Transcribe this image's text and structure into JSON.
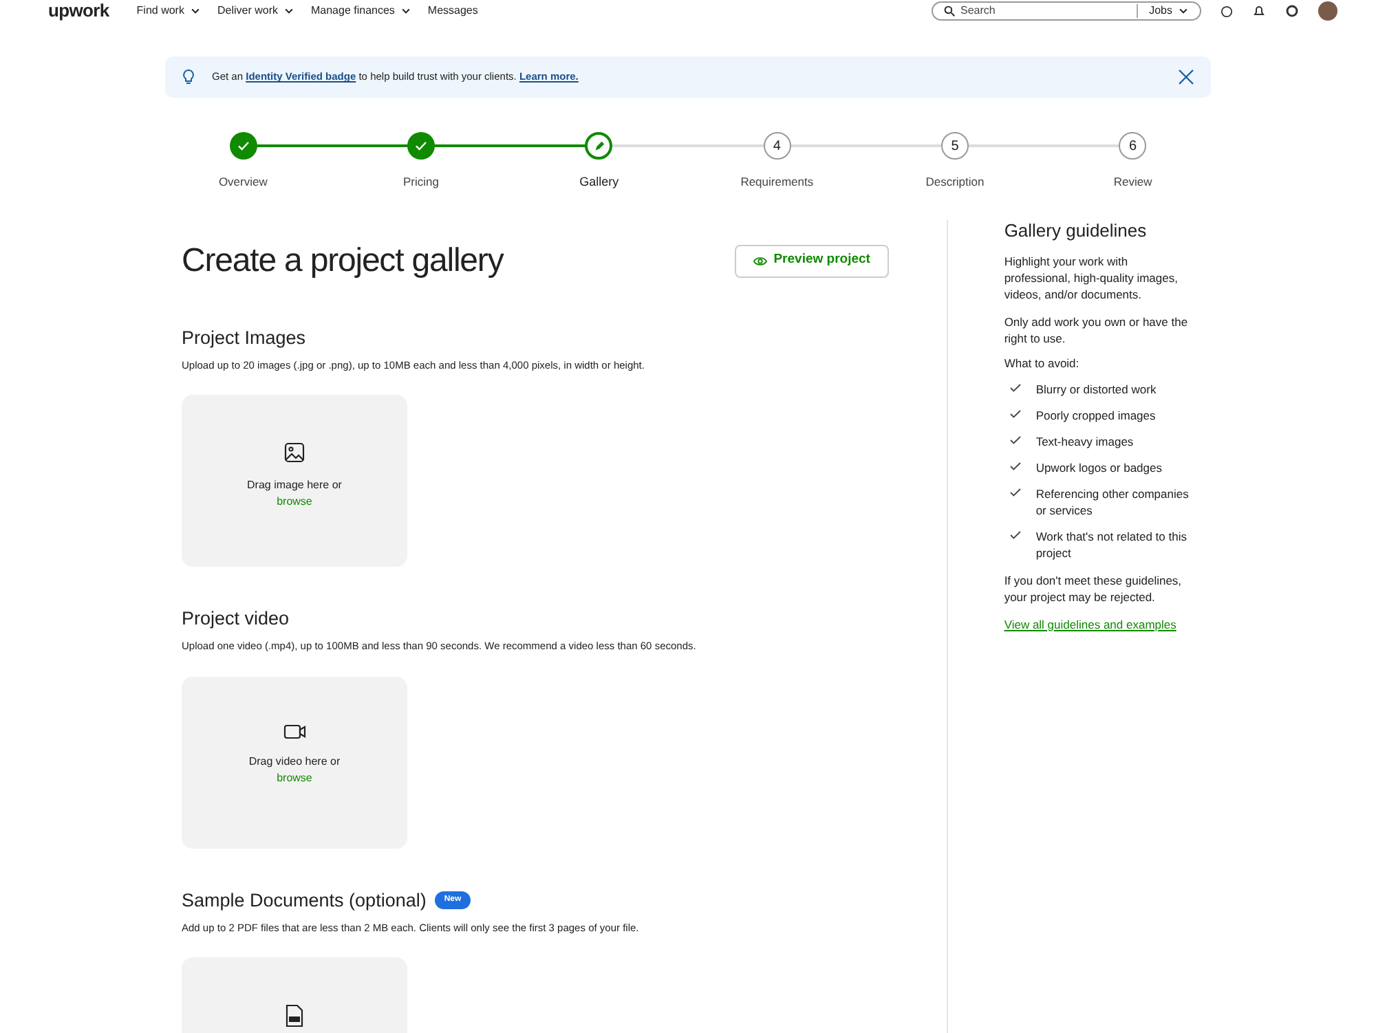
{
  "nav": {
    "logo": "upwork",
    "links": [
      {
        "label": "Find work",
        "dropdown": true
      },
      {
        "label": "Deliver work",
        "dropdown": true
      },
      {
        "label": "Manage finances",
        "dropdown": true
      },
      {
        "label": "Messages",
        "dropdown": false
      }
    ],
    "search": {
      "placeholder": "Search",
      "scope": "Jobs"
    }
  },
  "banner": {
    "before": "Get an ",
    "badge_link": "Identity Verified badge",
    "middle": " to help build trust with your clients. ",
    "learn_link": "Learn more."
  },
  "steps": [
    {
      "label": "Overview",
      "kind": "done"
    },
    {
      "label": "Pricing",
      "kind": "done"
    },
    {
      "label": "Gallery",
      "kind": "current"
    },
    {
      "label": "Requirements",
      "kind": "upcoming",
      "number": "4"
    },
    {
      "label": "Description",
      "kind": "upcoming",
      "number": "5"
    },
    {
      "label": "Review",
      "kind": "upcoming",
      "number": "6"
    }
  ],
  "title": "Create a project gallery",
  "preview_button": "Preview project",
  "sections": [
    {
      "heading": "Project Images",
      "description": "Upload up to 20 images (.jpg or .png), up to 10MB each and less than 4,000 pixels, in width or height.",
      "kind": "image",
      "drop_text": "Drag image here or",
      "browse": "browse"
    },
    {
      "heading": "Project video",
      "description": "Upload one video (.mp4), up to 100MB and less than 90 seconds. We recommend a video less than 60 seconds.",
      "kind": "video",
      "drop_text": "Drag video here or",
      "browse": "browse"
    },
    {
      "heading": "Sample Documents (optional)",
      "badge": "New",
      "description": "Add up to 2 PDF files that are less than 2 MB each. Clients will only see the first 3 pages of your file.",
      "kind": "pdf"
    }
  ],
  "guidelines": {
    "title": "Gallery guidelines",
    "paragraphs": [
      "Highlight your work with professional, high-quality images, videos, and/or documents.",
      "Only add work you own or have the right to use."
    ],
    "avoid_heading": "What to avoid:",
    "avoid": [
      "Blurry or distorted work",
      "Poorly cropped images",
      "Text-heavy images",
      "Upwork logos or badges",
      "Referencing other companies or services",
      "Work that's not related to this project"
    ],
    "footer": "If you don't meet these guidelines, your project may be rejected.",
    "link": "View all guidelines and examples"
  }
}
